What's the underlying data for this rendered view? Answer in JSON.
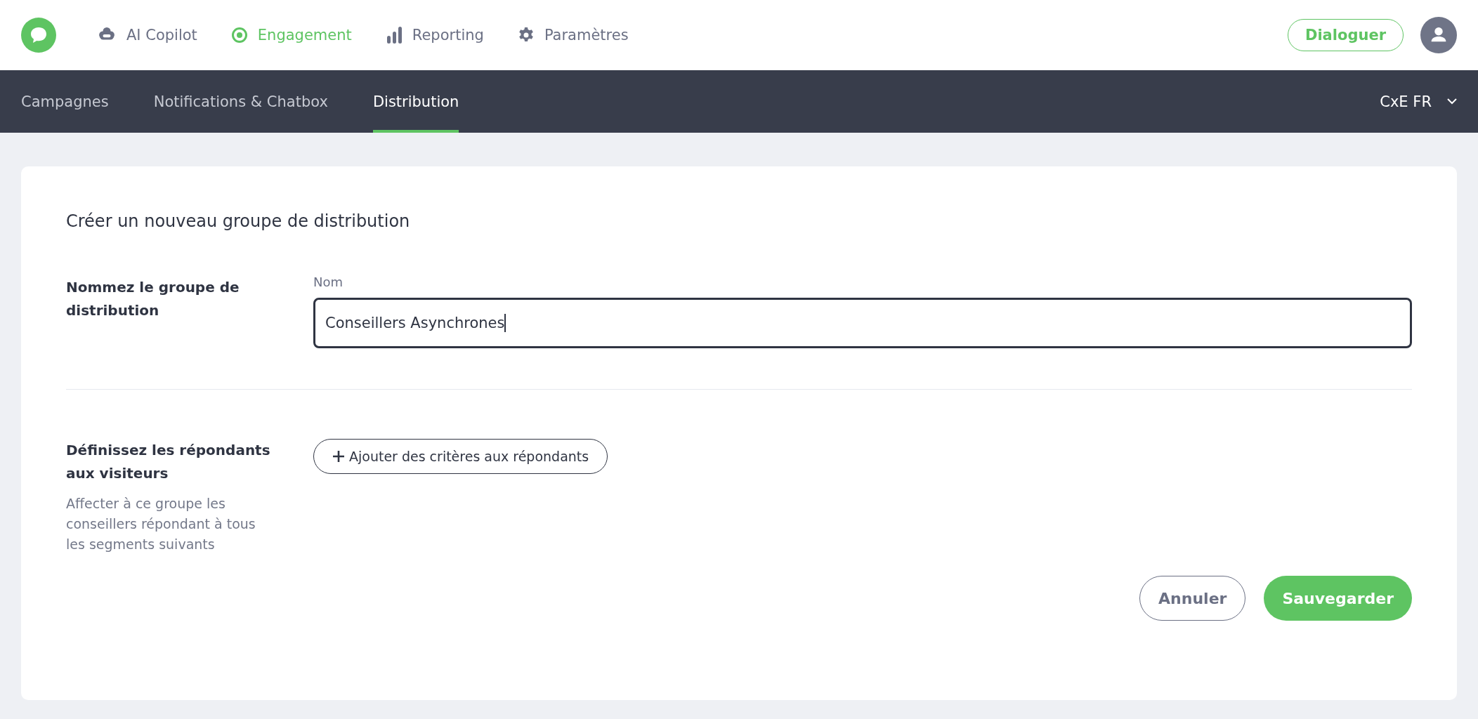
{
  "top_nav": {
    "items": [
      {
        "label": "AI Copilot",
        "selected": false
      },
      {
        "label": "Engagement",
        "selected": true
      },
      {
        "label": "Reporting",
        "selected": false
      },
      {
        "label": "Paramètres",
        "selected": false
      }
    ],
    "chat_button": "Dialoguer"
  },
  "sub_nav": {
    "tabs": [
      {
        "label": "Campagnes",
        "selected": false
      },
      {
        "label": "Notifications & Chatbox",
        "selected": false
      },
      {
        "label": "Distribution",
        "selected": true
      }
    ],
    "workspace": "CxE FR"
  },
  "form": {
    "title": "Créer un nouveau groupe de distribution",
    "sections": [
      {
        "kind": "text_field",
        "heading": "Nommez le groupe de distribution",
        "field_label": "Nom",
        "value": "Conseillers Asynchrones",
        "focused": true
      },
      {
        "kind": "add_button",
        "heading": "Définissez les répondants aux visiteurs",
        "description": "Affecter à ce groupe les conseillers répondant à tous les segments suivants",
        "button": "Ajouter des critères aux répondants"
      }
    ],
    "cancel": "Annuler",
    "save": "Sauvegarder"
  }
}
